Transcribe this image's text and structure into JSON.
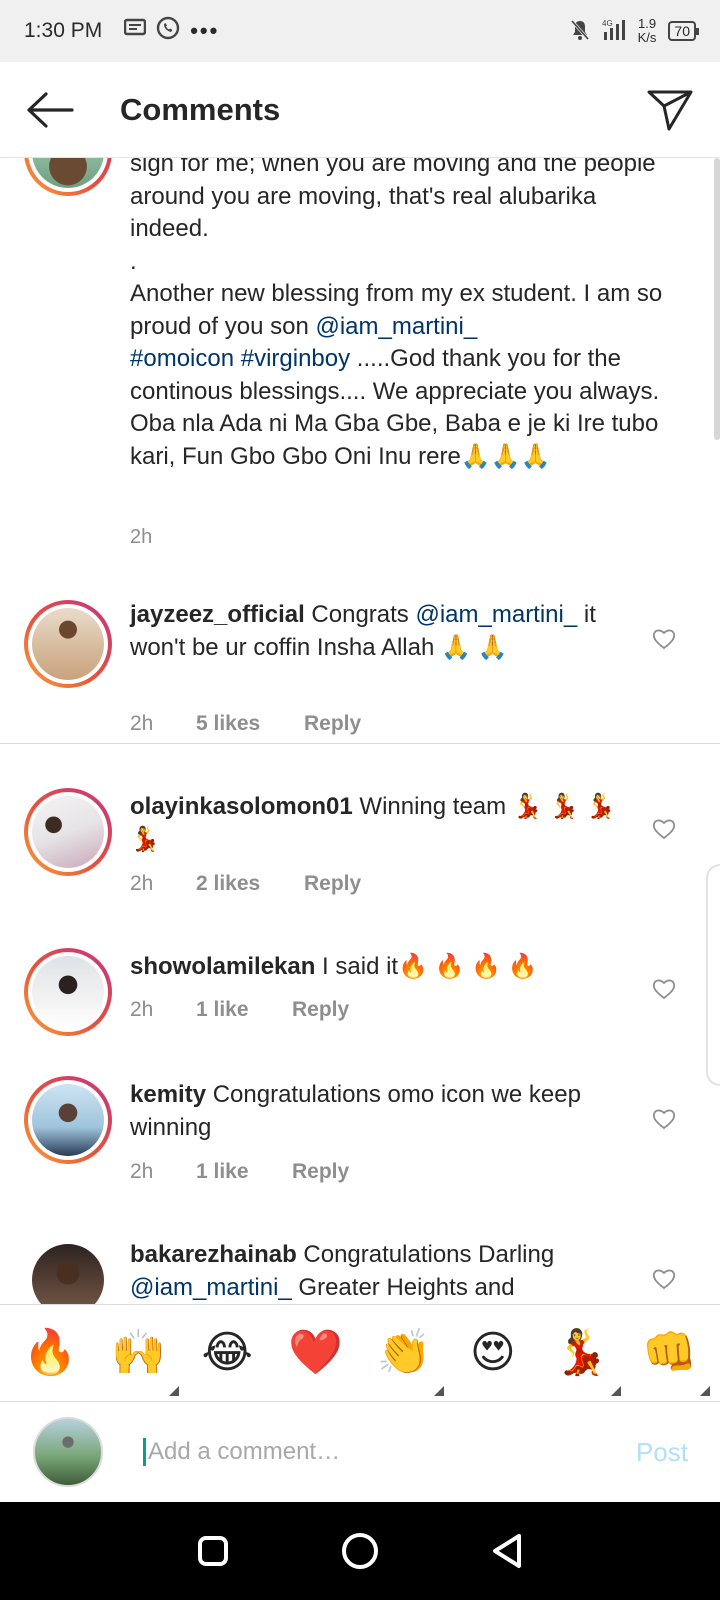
{
  "status_bar": {
    "time": "1:30 PM",
    "net_speed_value": "1.9",
    "net_speed_unit": "K/s",
    "network_label": "4G",
    "battery": "70"
  },
  "header": {
    "title": "Comments"
  },
  "caption": {
    "text_part1": "sign for me; when you are moving and the people around you are moving, that's real alubarika indeed.\n.\nAnother new blessing from my ex student. I am so proud of you son ",
    "mention": "@iam_martini_",
    "hashtag1": "#omoicon",
    "hashtag2": "#virginboy",
    "text_part2": " .....God thank you for the continous blessings.... We appreciate you always. Oba nla Ada ni Ma Gba Gbe, Baba e je ki Ire tubo kari, Fun Gbo Gbo Oni Inu rere🙏🙏🙏",
    "time": "2h"
  },
  "comments": [
    {
      "username": "jayzeez_official",
      "text_before": " Congrats ",
      "mention": "@iam_martini_",
      "text_after": " it won't be ur coffin Insha Allah 🙏 🙏",
      "time": "2h",
      "likes": "5 likes",
      "reply": "Reply"
    },
    {
      "username": "olayinkasolomon01",
      "text": " Winning team 💃 💃 💃 💃",
      "time": "2h",
      "likes": "2 likes",
      "reply": "Reply"
    },
    {
      "username": "showolamilekan",
      "text": " I said it🔥 🔥 🔥 🔥",
      "time": "2h",
      "likes": "1 like",
      "reply": "Reply"
    },
    {
      "username": "kemity",
      "text": " Congratulations omo icon we keep winning",
      "time": "2h",
      "likes": "1 like",
      "reply": "Reply"
    },
    {
      "username": "bakarezhainab",
      "text_before": " Congratulations Darling ",
      "mention": "@iam_martini_",
      "text_after": " Greater Heights and"
    }
  ],
  "emoji_bar": [
    "🔥",
    "🙌",
    "😂",
    "❤️",
    "👏",
    "😍",
    "💃",
    "👊"
  ],
  "input": {
    "placeholder": "Add a comment…",
    "post_label": "Post"
  },
  "colors": {
    "link": "#003569",
    "meta_gray": "#8e8e8e",
    "post_disabled": "#b2dffc"
  }
}
